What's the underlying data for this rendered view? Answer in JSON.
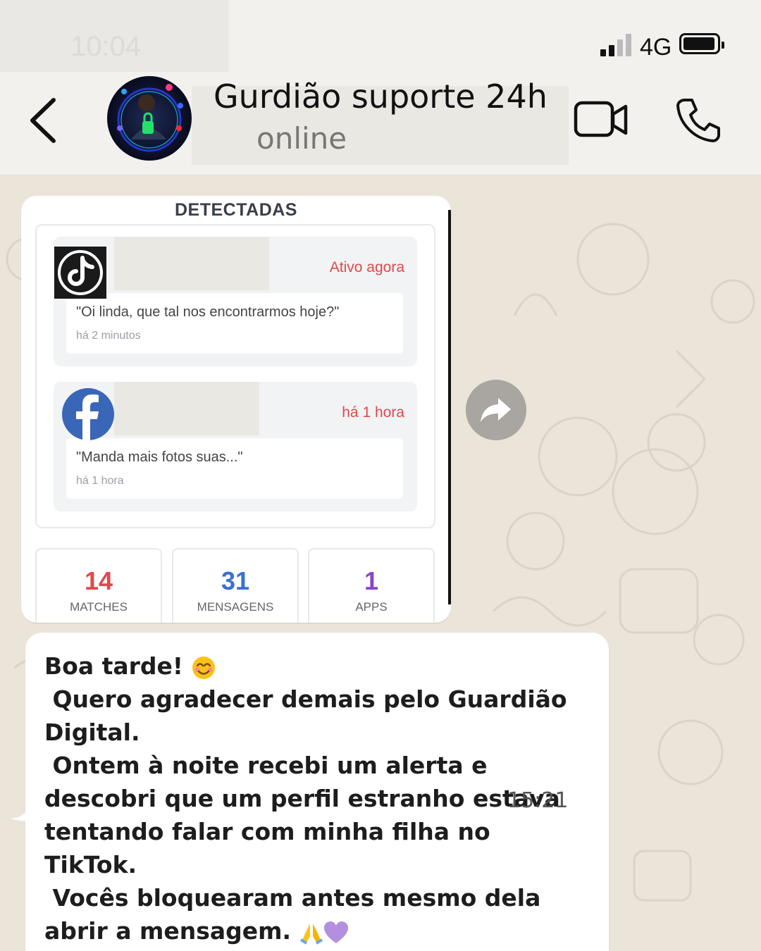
{
  "status_bar": {
    "time": "10:04",
    "network": "4G"
  },
  "header": {
    "contact_name": "Gurdião suporte 24h",
    "status": "online"
  },
  "image_message": {
    "title": "DETECTADAS",
    "cards": [
      {
        "app": "TikTok",
        "status": "Ativo agora",
        "quote": "\"Oi linda, que tal nos encontrarmos hoje?\"",
        "time": "há 2 minutos"
      },
      {
        "app": "Facebook",
        "status": "há 1 hora",
        "quote": "\"Manda mais fotos suas...\"",
        "time": "há 1 hora"
      }
    ],
    "stats": [
      {
        "value": "14",
        "label": "MATCHES",
        "color": "#e0484b"
      },
      {
        "value": "31",
        "label": "MENSAGENS",
        "color": "#3b6fd4"
      },
      {
        "value": "1",
        "label": "APPS",
        "color": "#8b44c9"
      }
    ]
  },
  "text_message": {
    "line1": "Boa tarde! ",
    "line2": " Quero agradecer demais pelo Guardião",
    "line3": "Digital.",
    "line4": " Ontem à noite recebi um alerta e",
    "line5": "descobri que um perfil estranho estava",
    "line6": "tentando falar com minha filha no",
    "line7": "TikTok.",
    "line8": " Vocês bloquearam antes mesmo dela",
    "line9": "abrir a mensagem. ",
    "time": "15:21"
  }
}
